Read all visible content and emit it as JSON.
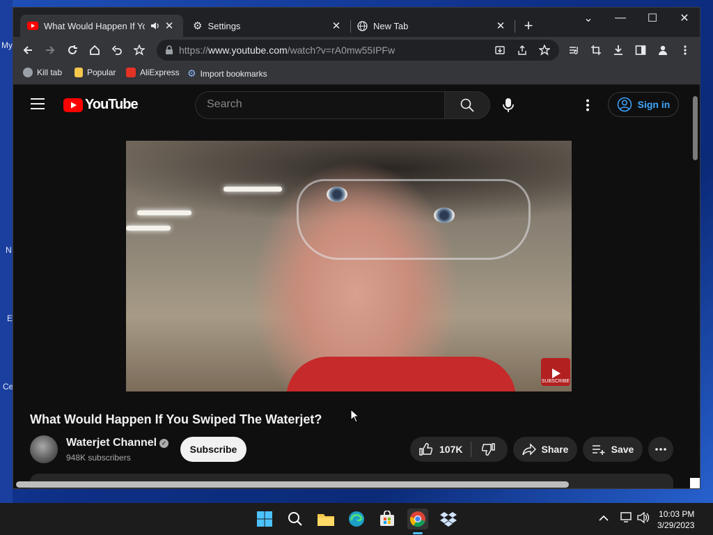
{
  "desktop": {
    "labels": [
      "My",
      "N",
      "E",
      "Ce"
    ]
  },
  "browser": {
    "tabs": [
      {
        "title": "What Would Happen If You Swiped The Waterjet?",
        "close": "✕"
      },
      {
        "title": "Settings",
        "close": "✕"
      },
      {
        "title": "New Tab",
        "close": "✕"
      }
    ],
    "new_tab": "+",
    "window_controls": {
      "tab_search": "⌄",
      "minimize": "—",
      "maximize": "☐",
      "close": "✕"
    },
    "url_prefix": "https://",
    "url_host": "www.youtube.com",
    "url_path": "/watch?v=rA0mw55IPFw",
    "bookmarks": [
      {
        "label": "Kill tab",
        "icon": "globe-icon",
        "color": "#9aa0a6"
      },
      {
        "label": "Popular",
        "icon": "folder-icon",
        "color": "#f5c84c"
      },
      {
        "label": "AliExpress",
        "icon": "aliexpress-icon",
        "color": "#e43225"
      },
      {
        "label": "Import bookmarks",
        "icon": "gear-icon",
        "color": "#8ab4f8"
      }
    ]
  },
  "youtube": {
    "logo_text": "YouTube",
    "search_placeholder": "Search",
    "sign_in": "Sign in",
    "video_title": "What Would Happen If You Swiped The Waterjet?",
    "watermark": "SUBSCRIBE",
    "channel_name": "Waterjet Channel",
    "subscribers": "948K subscribers",
    "subscribe": "Subscribe",
    "likes": "107K",
    "share": "Share",
    "save": "Save",
    "brand_red": "#ff0000",
    "link_blue": "#3ea6ff"
  },
  "taskbar": {
    "apps": [
      "windows-start-icon",
      "search-icon",
      "file-explorer-icon",
      "edge-icon",
      "store-icon",
      "chrome-icon",
      "dropbox-icon"
    ],
    "time": "10:03 PM",
    "date": "3/29/2023"
  }
}
